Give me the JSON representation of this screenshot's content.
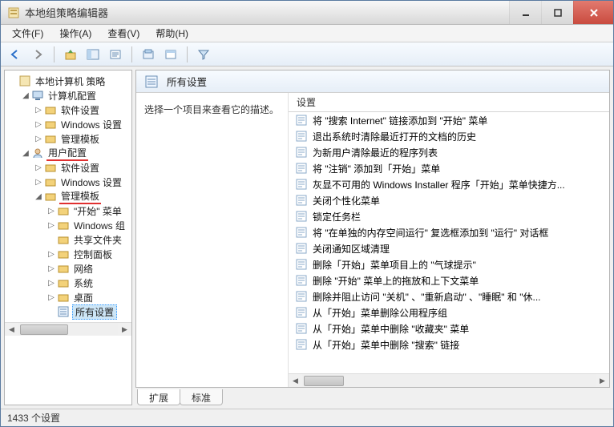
{
  "window": {
    "title": "本地组策略编辑器"
  },
  "menu": {
    "file": "文件(F)",
    "action": "操作(A)",
    "view": "查看(V)",
    "help": "帮助(H)"
  },
  "tree": {
    "root": "本地计算机 策略",
    "computer_cfg": "计算机配置",
    "software_settings": "软件设置",
    "windows_settings": "Windows 设置",
    "admin_templates": "管理模板",
    "user_cfg": "用户配置",
    "start_menu": "\"开始\" 菜单",
    "windows_group": "Windows 组",
    "shared_folders": "共享文件夹",
    "control_panel": "控制面板",
    "network": "网络",
    "system": "系统",
    "desktop": "桌面",
    "all_settings": "所有设置"
  },
  "detail": {
    "title": "所有设置",
    "desc": "选择一个项目来查看它的描述。",
    "col_setting": "设置",
    "items": [
      "将 \"搜索 Internet\" 链接添加到 \"开始\" 菜单",
      "退出系统时清除最近打开的文档的历史",
      "为新用户清除最近的程序列表",
      "将 \"注销\" 添加到「开始」菜单",
      "灰显不可用的 Windows Installer 程序「开始」菜单快捷方...",
      "关闭个性化菜单",
      "锁定任务栏",
      "将 \"在单独的内存空间运行\" 复选框添加到 \"运行\" 对话框",
      "关闭通知区域清理",
      "删除「开始」菜单项目上的 \"气球提示\"",
      "删除 \"开始\" 菜单上的拖放和上下文菜单",
      "删除并阻止访问 \"关机\" 、\"重新启动\" 、\"睡眠\" 和 \"休...",
      "从「开始」菜单删除公用程序组",
      "从「开始」菜单中删除 \"收藏夹\" 菜单",
      "从「开始」菜单中删除 \"搜索\" 链接"
    ]
  },
  "tabs": {
    "extended": "扩展",
    "standard": "标准"
  },
  "status": {
    "count": "1433 个设置"
  }
}
